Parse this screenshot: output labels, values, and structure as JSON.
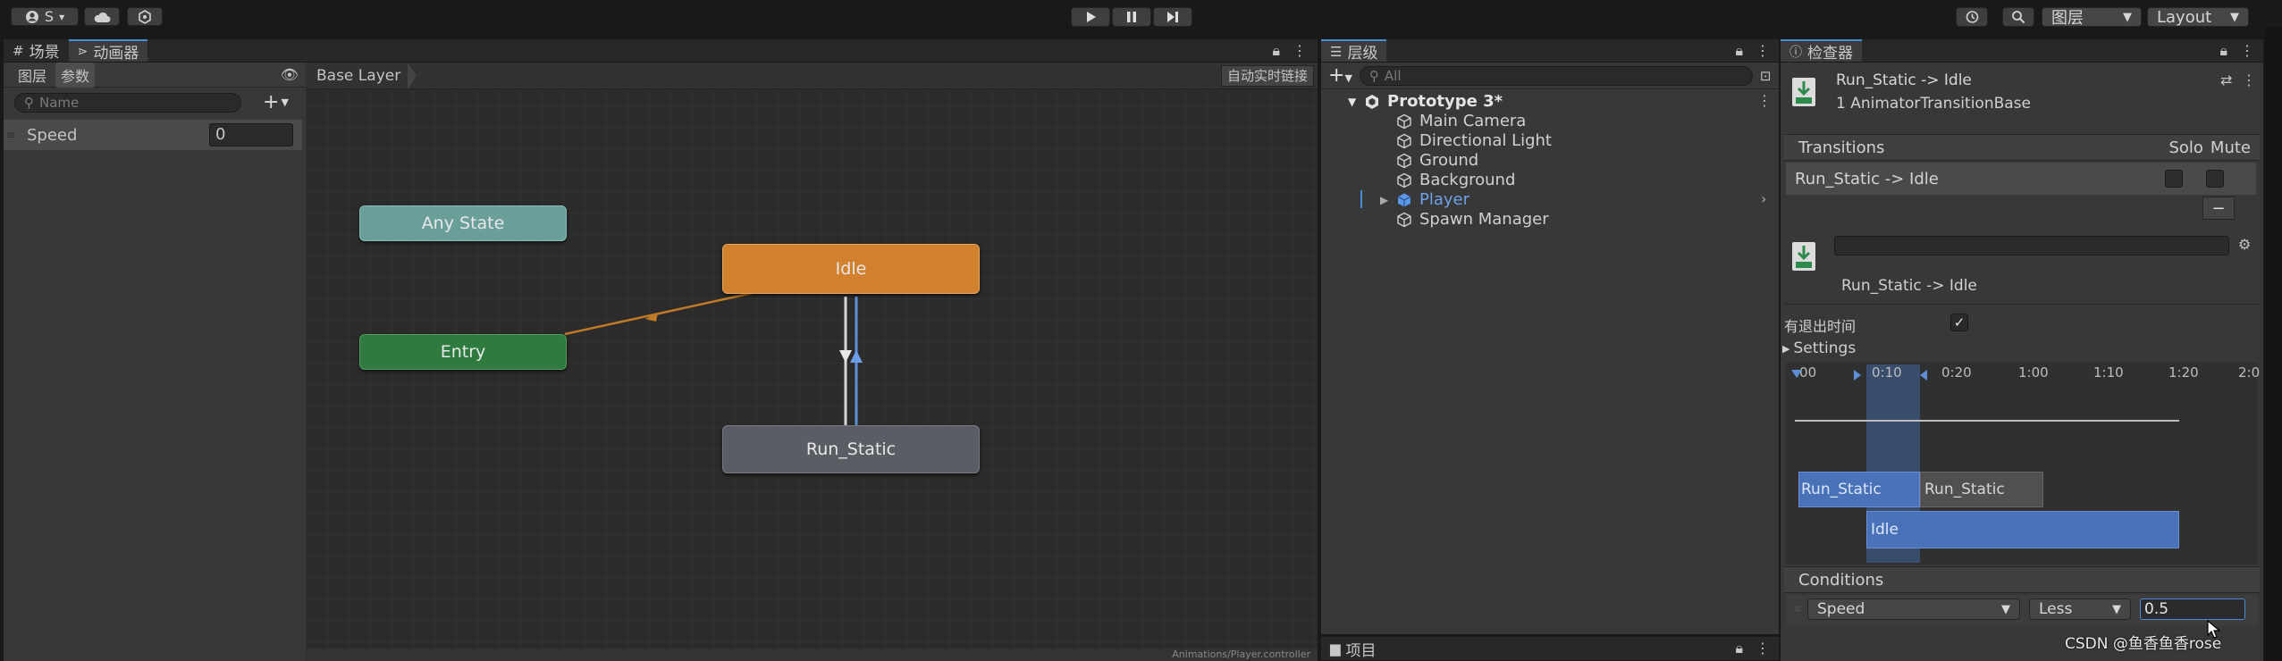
{
  "toolbar": {
    "account_label": "S",
    "account_caret": "▾",
    "play_icon": "play-icon",
    "layers_label": "图层",
    "layout_label": "Layout"
  },
  "left_panel": {
    "tabs": [
      "场景",
      "动画器"
    ],
    "sub_tabs": [
      "图层",
      "参数"
    ],
    "search_placeholder": "Name",
    "add_label": "+",
    "params": [
      {
        "name": "Speed",
        "value": "0"
      }
    ]
  },
  "animator": {
    "breadcrumb": "Base Layer",
    "live_link": "自动实时链接",
    "footer_path": "Animations/Player.controller",
    "states": {
      "any": "Any State",
      "entry": "Entry",
      "idle": "Idle",
      "run": "Run_Static"
    }
  },
  "hierarchy": {
    "tab": "层级",
    "search_placeholder": "All",
    "scene": "Prototype 3*",
    "items": [
      "Main Camera",
      "Directional Light",
      "Ground",
      "Background",
      "Player",
      "Spawn Manager"
    ],
    "project_tab": "项目"
  },
  "inspector": {
    "tab": "检查器",
    "title": "Run_Static -> Idle",
    "subtitle": "1 AnimatorTransitionBase",
    "transitions_header": "Transitions",
    "solo": "Solo",
    "mute": "Mute",
    "transition_item": "Run_Static -> Idle",
    "minus": "−",
    "name_label": "Run_Static -> Idle",
    "has_exit_time": "有退出时间",
    "settings": "Settings",
    "timeline_ticks": [
      ":00",
      "0:10",
      "0:20",
      "1:00",
      "1:10",
      "1:20",
      "2:0"
    ],
    "clip_a1": "Run_Static",
    "clip_a2": "Run_Static",
    "clip_b": "Idle",
    "conditions_header": "Conditions",
    "condition": {
      "param": "Speed",
      "op": "Less",
      "value": "0.5"
    }
  },
  "watermark": "CSDN @鱼香鱼香rose",
  "colors": {
    "any_state": "#6a9e98",
    "entry": "#2f7a3e",
    "idle": "#d1802e",
    "run": "#5a5d63",
    "selection_blue": "#4a72b8"
  }
}
